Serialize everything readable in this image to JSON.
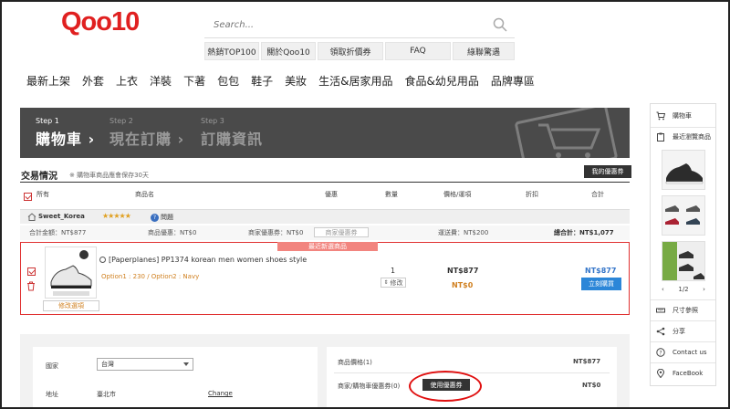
{
  "brand": {
    "logo": "Qoo10",
    "accent": "#e02020"
  },
  "search": {
    "placeholder": "Search..."
  },
  "quick_links": [
    "熱銷TOP100",
    "關於Qoo10",
    "領取折價券",
    "FAQ",
    "綠聯驚遇"
  ],
  "categories": [
    "最新上架",
    "外套",
    "上衣",
    "洋裝",
    "下著",
    "包包",
    "鞋子",
    "美妝",
    "生活&居家用品",
    "食品&幼兒用品",
    "品牌專區"
  ],
  "steps": [
    {
      "num": "Step 1",
      "label": "購物車"
    },
    {
      "num": "Step 2",
      "label": "現在訂購"
    },
    {
      "num": "Step 3",
      "label": "訂購資訊"
    }
  ],
  "step_sep": "›",
  "cart": {
    "title": "交易情況",
    "note": "※ 購物車商品應會保存30天",
    "my_coupon": "我的優惠券",
    "headers": {
      "all": "所有",
      "product": "商品名",
      "discount": "優惠",
      "qty": "數量",
      "price": "價格/運項",
      "rebate": "折扣",
      "total": "合計"
    },
    "seller": {
      "name": "Sweet_Korea",
      "stars": "★★★★★",
      "qa_icon": "?",
      "qa": "問題"
    },
    "summary": {
      "total_amount": "合計金額：NT$877",
      "product_discount": "商品優惠：NT$0",
      "shop_coupon": "商家優惠券：NT$0",
      "shop_coupon_btn": "商家優惠券",
      "shipping": "運送費：NT$200",
      "grand_total": "總合計：NT$1,077"
    },
    "item": {
      "latest_tag": "最近新選商品",
      "title": "[Paperplanes] PP1374 korean men women shoes style",
      "options": "Option1 : 230 / Option2 : Navy",
      "edit_options": "修改選項",
      "qty": "1",
      "qty_edit": "修改",
      "price": "NT$877",
      "discount_price": "NT$0",
      "total": "NT$877",
      "buy_now": "立刻購買"
    }
  },
  "order_form": {
    "country_label": "國家",
    "country_value": "台灣",
    "address_label": "地址",
    "address_value": "臺北市",
    "change": "Change"
  },
  "order_summary": {
    "product_price_label": "商品價格(1)",
    "product_price_value": "NT$877",
    "coupon_label": "商家/購物車優惠券(0)",
    "use_coupon": "使用優惠券",
    "coupon_value": "NT$0"
  },
  "sidebar": {
    "cart": "購物車",
    "recent": "最近瀏覽商品",
    "pager": {
      "prev": "‹",
      "page": "1/2",
      "next": "›"
    },
    "size_chart": "尺寸參照",
    "share": "分享",
    "contact": "Contact us",
    "facebook": "FaceBook"
  },
  "colors": {
    "banner": "#4a4a4a",
    "buy_button": "#2b86d8",
    "highlight": "#e03030",
    "orange_text": "#d08020"
  }
}
